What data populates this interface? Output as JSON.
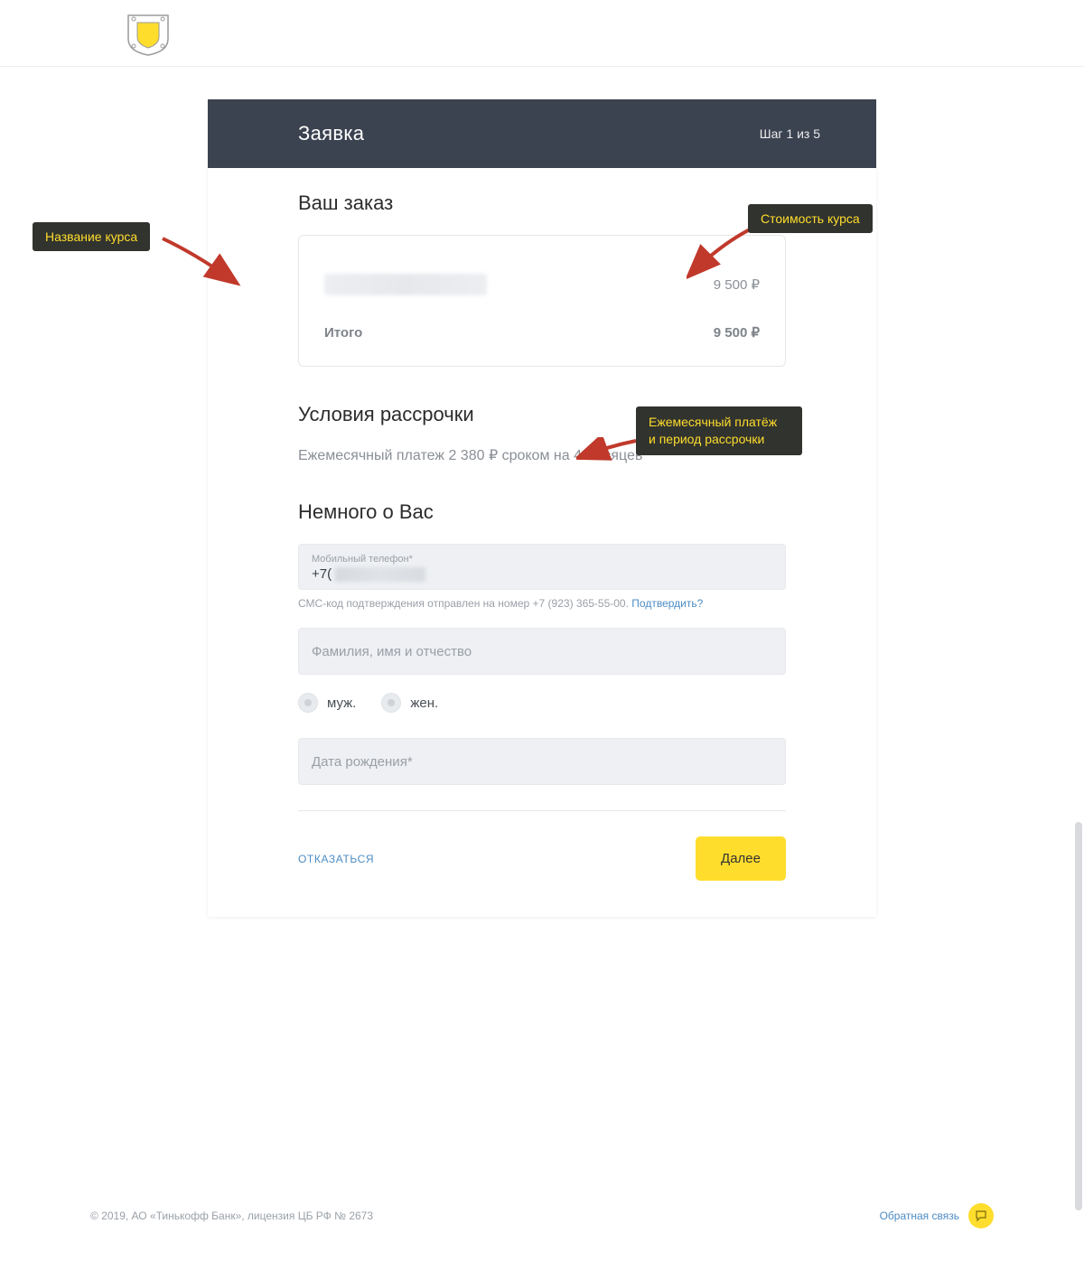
{
  "header": {
    "title": "Заявка",
    "step": "Шаг 1 из 5"
  },
  "order": {
    "section": "Ваш заказ",
    "course_name": "",
    "price": "9 500 ₽",
    "total_label": "Итого",
    "total_value": "9 500 ₽"
  },
  "installment": {
    "section": "Условия рассрочки",
    "text": "Ежемесячный платеж 2 380 ₽ сроком на 4 месяцев"
  },
  "about": {
    "section": "Немного о Вас",
    "phone_label": "Мобильный телефон*",
    "phone_prefix": "+7(",
    "sms_hint": "СМС-код подтверждения отправлен на номер +7 (923) 365-55-00.",
    "sms_confirm": "Подтвердить?",
    "fio_placeholder": "Фамилия, имя и отчество",
    "gender_male": "муж.",
    "gender_female": "жен.",
    "dob_placeholder": "Дата рождения*"
  },
  "actions": {
    "decline": "ОТКАЗАТЬСЯ",
    "next": "Далее"
  },
  "footer": {
    "copyright": "© 2019, АО «Тинькофф Банк», лицензия ЦБ РФ № 2673",
    "feedback": "Обратная связь"
  },
  "annotations": {
    "course_name": "Название курса",
    "course_price": "Стоимость курса",
    "installment_line1": "Ежемесячный платёж",
    "installment_line2": "и период рассрочки"
  }
}
